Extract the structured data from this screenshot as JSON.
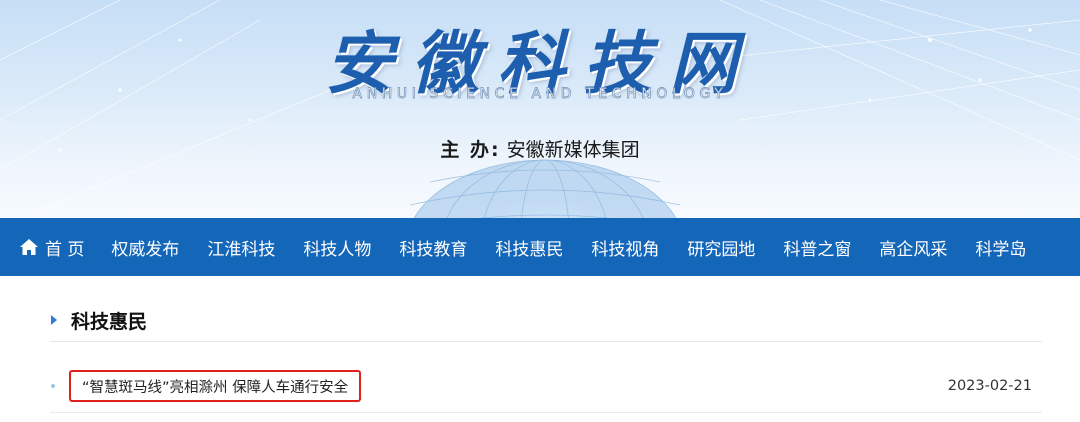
{
  "header": {
    "logo_title": "安徽科技网",
    "logo_subtitle": "ANHUI SCIENCE AND TECHNOLOGY",
    "host_label": "主  办:",
    "host_value": "安徽新媒体集团"
  },
  "nav": {
    "home_label": "首 页",
    "items": [
      "权威发布",
      "江淮科技",
      "科技人物",
      "科技教育",
      "科技惠民",
      "科技视角",
      "研究园地",
      "科普之窗",
      "高企风采",
      "科学岛"
    ]
  },
  "section": {
    "title": "科技惠民",
    "articles": [
      {
        "title": "“智慧斑马线”亮相滁州 保障人车通行安全",
        "date": "2023-02-21"
      }
    ]
  },
  "colors": {
    "nav_bg": "#1466b8",
    "highlight_border": "#e0201c",
    "logo": "#1d5fae"
  },
  "icons": {
    "home": "home-icon",
    "section": "triangle-right-icon",
    "bullet": "dot-icon"
  }
}
